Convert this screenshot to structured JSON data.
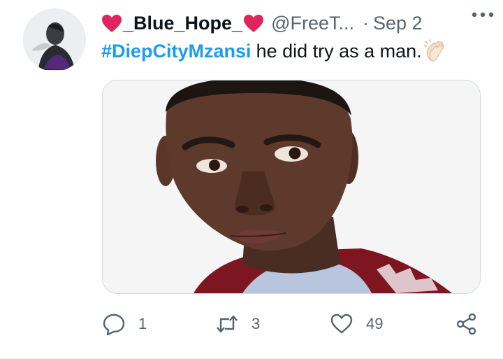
{
  "tweet": {
    "display_name": "_Blue_Hope_",
    "handle": "@FreeT...",
    "separator": "·",
    "date": "Sep 2",
    "hashtag": "#DiepCityMzansi",
    "text": "he did try as a man.",
    "emoji": "clapping-hands",
    "media_alt": "close-up portrait photo"
  },
  "actions": {
    "reply_count": "1",
    "retweet_count": "3",
    "like_count": "49"
  },
  "colors": {
    "accent": "#1d9bf0",
    "heart": "#e0245e",
    "muted": "#536471",
    "text": "#0f1419"
  }
}
